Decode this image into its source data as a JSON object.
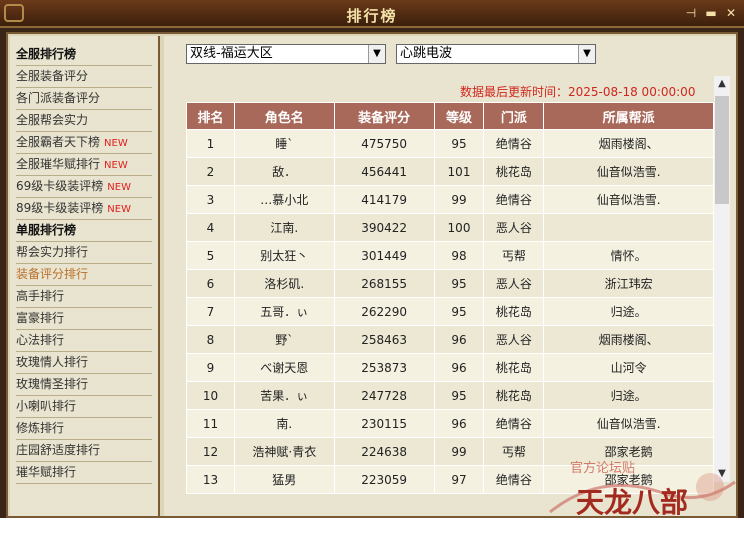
{
  "window": {
    "title": "排行榜"
  },
  "sidebar": {
    "items": [
      {
        "label": "全服排行榜",
        "type": "header"
      },
      {
        "label": "全服装备评分",
        "type": "item"
      },
      {
        "label": "各门派装备评分",
        "type": "item"
      },
      {
        "label": "全服帮会实力",
        "type": "item"
      },
      {
        "label": "全服霸者天下榜",
        "type": "item",
        "badge": "NEW"
      },
      {
        "label": "全服璀华赋排行",
        "type": "item",
        "badge": "NEW"
      },
      {
        "label": "69级卡级装评榜",
        "type": "item",
        "badge": "NEW"
      },
      {
        "label": "89级卡级装评榜",
        "type": "item",
        "badge": "NEW"
      },
      {
        "label": "单服排行榜",
        "type": "header"
      },
      {
        "label": "帮会实力排行",
        "type": "item"
      },
      {
        "label": "装备评分排行",
        "type": "item",
        "active": true
      },
      {
        "label": "高手排行",
        "type": "item"
      },
      {
        "label": "富豪排行",
        "type": "item"
      },
      {
        "label": "心法排行",
        "type": "item"
      },
      {
        "label": "玫瑰情人排行",
        "type": "item"
      },
      {
        "label": "玫瑰情圣排行",
        "type": "item"
      },
      {
        "label": "小喇叭排行",
        "type": "item"
      },
      {
        "label": "修炼排行",
        "type": "item"
      },
      {
        "label": "庄园舒适度排行",
        "type": "item"
      },
      {
        "label": "璀华赋排行",
        "type": "item"
      }
    ]
  },
  "filters": {
    "region": "双线-福运大区",
    "server": "心跳电波"
  },
  "update_time": "数据最后更新时间：2025-08-18 00:00:00",
  "table": {
    "headers": [
      "排名",
      "角色名",
      "装备评分",
      "等级",
      "门派",
      "所属帮派"
    ],
    "rows": [
      [
        "1",
        "睡`",
        "475750",
        "95",
        "绝情谷",
        "烟雨楼阁、"
      ],
      [
        "2",
        "敌．",
        "456441",
        "101",
        "桃花岛",
        "仙音似浩雪."
      ],
      [
        "3",
        "…慕小北",
        "414179",
        "99",
        "绝情谷",
        "仙音似浩雪."
      ],
      [
        "4",
        "江南.",
        "390422",
        "100",
        "恶人谷",
        ""
      ],
      [
        "5",
        "别太狂丶",
        "301449",
        "98",
        "丐帮",
        "情怀。"
      ],
      [
        "6",
        "洛杉矶.",
        "268155",
        "95",
        "恶人谷",
        "浙江玮宏"
      ],
      [
        "7",
        "五哥．ぃ",
        "262290",
        "95",
        "桃花岛",
        "归途。"
      ],
      [
        "8",
        "野`",
        "258463",
        "96",
        "恶人谷",
        "烟雨楼阁、"
      ],
      [
        "9",
        "べ谢天恩",
        "253873",
        "96",
        "桃花岛",
        "山河令"
      ],
      [
        "10",
        "苦果．ぃ",
        "247728",
        "95",
        "桃花岛",
        "归途。"
      ],
      [
        "11",
        "南.",
        "230115",
        "96",
        "绝情谷",
        "仙音似浩雪."
      ],
      [
        "12",
        "浩神赋·青衣",
        "224638",
        "99",
        "丐帮",
        "邵家老鹅"
      ],
      [
        "13",
        "猛男",
        "223059",
        "97",
        "绝情谷",
        "邵家老鹅"
      ]
    ]
  },
  "logo": {
    "text": "天龙八部",
    "sub": "官方论坛贴"
  }
}
